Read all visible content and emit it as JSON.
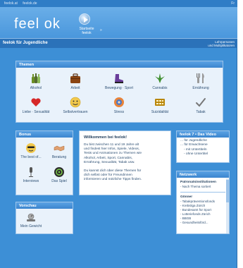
{
  "topbar": {
    "link1": "feelok.at",
    "link2": "feelok.de",
    "right": "Fr"
  },
  "header": {
    "logo": "feel ok",
    "home_label_1": "Startseite",
    "home_label_2": "feelok",
    "home_sep": "»"
  },
  "titlebar": {
    "title": "feelok für Jugendliche",
    "right_1": "Lehrpersonen",
    "right_2": "und Multiplikatoren"
  },
  "themen": {
    "title": "Themen",
    "items": [
      "Alkohol",
      "Arbeit",
      "Bewegung · Sport",
      "Cannabis",
      "Ernährung",
      "Liebe · Sexualität",
      "Selbstvertrauen",
      "Stress",
      "Suizidalität",
      "Tabak"
    ]
  },
  "bonus": {
    "title": "Bonus",
    "items": [
      "The best of...",
      "Beratung",
      "Interviews",
      "Das Spiel"
    ]
  },
  "vorschau": {
    "title": "Vorschau",
    "items": [
      "Mein Gewicht"
    ]
  },
  "welcome": {
    "heading": "Willkommen bei feelok!",
    "p1": [
      "Du bist zwischen 11 und 19 Jahre alt",
      "und findest hier Infos, Spiele, Videos,",
      "Tests und Animationen zu Themen wie",
      "Alkohol, Arbeit, Sport, Cannabis,",
      "Ernährung, Sexualität, Tabak usw."
    ],
    "p2": [
      "Du kannst dich über diese Themen für",
      "dich selbst oder für Freundinnen",
      "informieren und nützliche Tipps finden."
    ]
  },
  "video": {
    "title": "feelok 7 • Das Video",
    "items": [
      "... für Jugendliche",
      "... für Erwachsene",
      "- mit Untertiteln",
      "- ohne Untertitel"
    ]
  },
  "netzwerk": {
    "title": "Netzwerk",
    "sec1": "Patronatsinstitutionen",
    "sec1_items": [
      "- Nach Thema sortiert"
    ],
    "sec2": "Gönner",
    "sec2_items": [
      "- Tabakpräventionsfonds",
      "- Krebsliga Zürich",
      "- Bundesamt für Sport",
      "- Lotteriefonds Zürich",
      "- BBGB",
      "- Gesundheitsförd..."
    ]
  },
  "colors": {
    "background": "#3d8fd6",
    "panel_header": "#3b85cf",
    "panel": "#ffffff"
  },
  "icons": [
    "beer-bottles-icon",
    "briefcase-icon",
    "sneaker-icon",
    "cannabis-leaf-icon",
    "fork-knife-icon",
    "heart-icon",
    "smiley-face-icon",
    "stress-face-icon",
    "pill-pack-icon",
    "cigarette-check-icon",
    "cool-smiley-icon",
    "handshake-icon",
    "microphone-icon",
    "game-globe-icon",
    "scale-icon"
  ]
}
